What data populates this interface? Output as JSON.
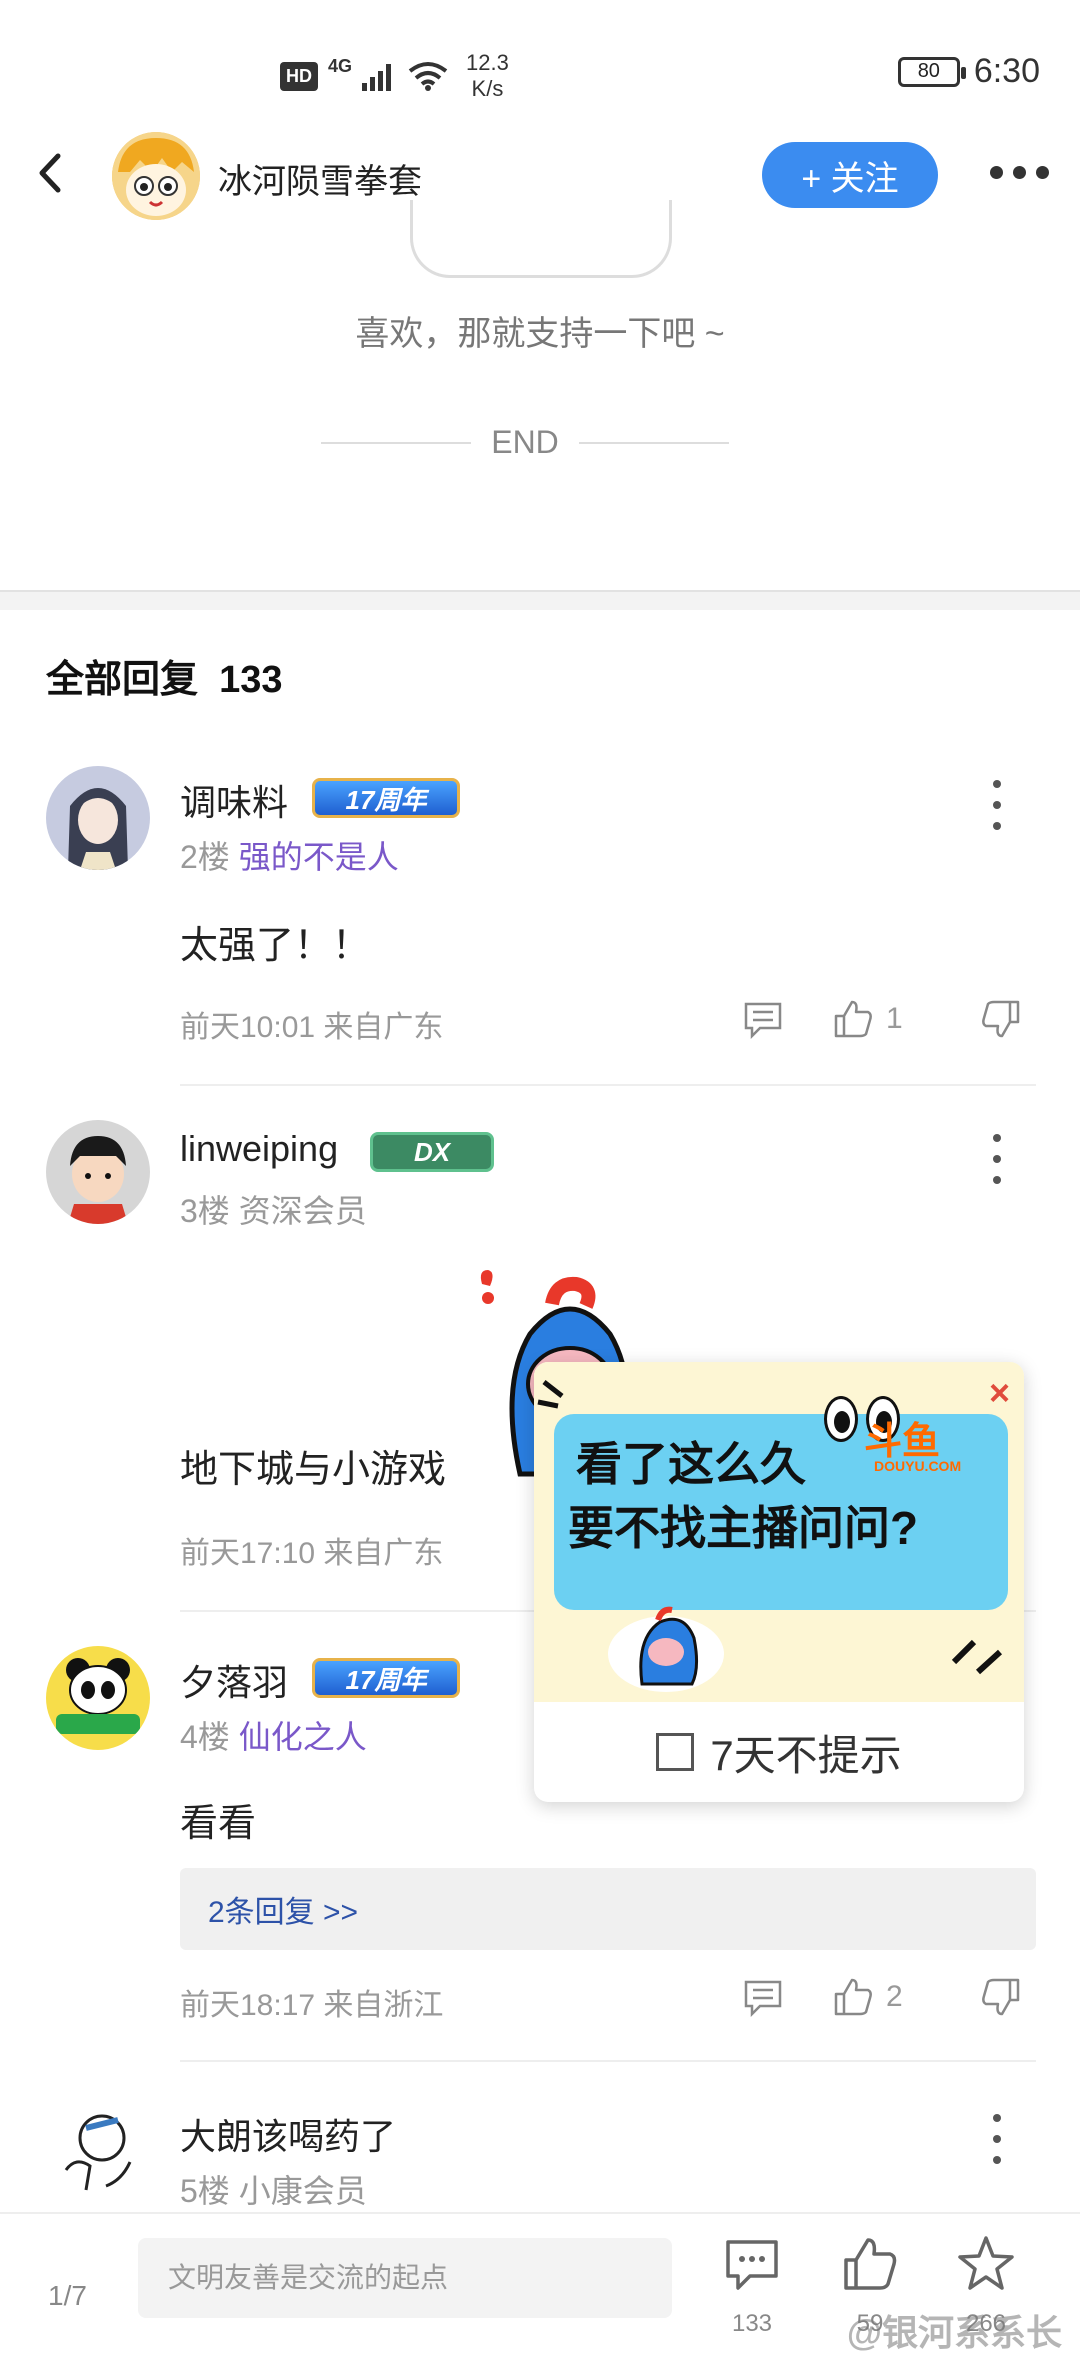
{
  "status_bar": {
    "hd": "HD",
    "network": "4G",
    "speed_value": "12.3",
    "speed_unit": "K/s",
    "battery": "80",
    "time": "6:30"
  },
  "header": {
    "author_name": "冰河陨雪拳套",
    "follow_label": "+ 关注"
  },
  "article": {
    "support_text": "喜欢，那就支持一下吧 ~",
    "end_label": "END"
  },
  "replies": {
    "title": "全部回复",
    "count": "133"
  },
  "comments": [
    {
      "name": "调味料",
      "badge": "17周年",
      "floor": "2楼",
      "title": "强的不是人",
      "text": "太强了！！",
      "meta": "前天10:01 来自广东",
      "likes": "1"
    },
    {
      "name": "linweiping",
      "badge": "DX",
      "floor": "3楼",
      "title": "资深会员",
      "text": "地下城与小游戏",
      "meta": "前天17:10 来自广东"
    },
    {
      "name": "夕落羽",
      "badge": "17周年",
      "floor": "4楼",
      "title": "仙化之人",
      "text": "看看",
      "sub_replies": "2条回复 >>",
      "meta": "前天18:17 来自浙江",
      "likes": "2"
    },
    {
      "name": "大朗该喝药了",
      "floor": "5楼",
      "title": "小康会员"
    }
  ],
  "ad": {
    "line1": "看了这么久",
    "line2": "要不找主播问问?",
    "brand": "斗鱼",
    "brand_sub": "DOUYU.COM",
    "close": "×",
    "dismiss_label": "7天不提示"
  },
  "bottom_bar": {
    "page": "1/7",
    "input_placeholder": "文明友善是交流的起点",
    "comment_count": "133",
    "like_count": "59",
    "fav_count": "266",
    "watermark": "@银河系系长"
  }
}
